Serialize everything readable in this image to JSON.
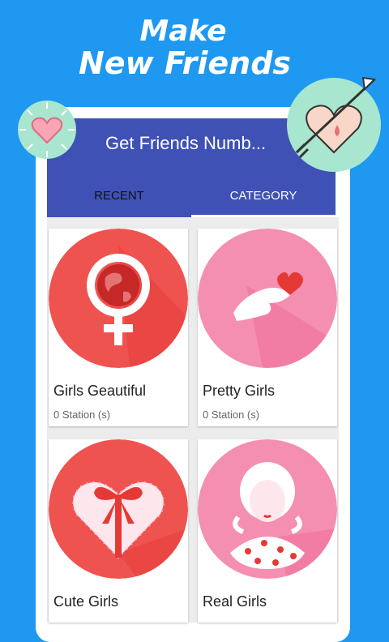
{
  "promo": {
    "line1": "Make",
    "line2": "New Friends"
  },
  "app": {
    "title": "Get Friends Numb..."
  },
  "tabs": [
    {
      "label": "RECENT"
    },
    {
      "label": "CATEGORY"
    }
  ],
  "cards": [
    {
      "title": "Girls Geautiful",
      "subtitle": "0 Station (s)",
      "icon": "female-symbol-globe-icon"
    },
    {
      "title": "Pretty Girls",
      "subtitle": "0 Station (s)",
      "icon": "hand-heart-icon"
    },
    {
      "title": "Cute Girls",
      "subtitle": "",
      "icon": "gift-heart-icon"
    },
    {
      "title": "Real Girls",
      "subtitle": "",
      "icon": "girl-portrait-icon"
    }
  ],
  "colors": {
    "background": "#1e98f0",
    "appbar": "#3f51b5",
    "card_red": "#ef5350",
    "card_pink": "#f48fb1",
    "decor_mint": "#a8e6cf"
  }
}
